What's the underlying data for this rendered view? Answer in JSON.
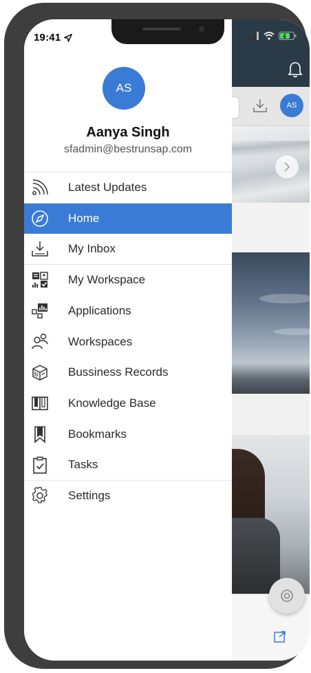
{
  "status_bar": {
    "time": "19:41"
  },
  "drawer": {
    "avatar_initials": "AS",
    "user_name": "Aanya Singh",
    "user_email": "sfadmin@bestrunsap.com",
    "items": [
      {
        "label": "Latest Updates",
        "icon": "rss-icon"
      },
      {
        "label": "Home",
        "icon": "compass-icon",
        "active": true
      },
      {
        "label": "My Inbox",
        "icon": "inbox-download-icon"
      },
      {
        "label": "My Workspace",
        "icon": "workspace-grid-icon"
      },
      {
        "label": "Applications",
        "icon": "applications-icon"
      },
      {
        "label": "Workspaces",
        "icon": "people-icon"
      },
      {
        "label": "Bussiness Records",
        "icon": "records-box-icon"
      },
      {
        "label": "Knowledge Base",
        "icon": "open-book-icon"
      },
      {
        "label": "Bookmarks",
        "icon": "bookmark-icon"
      },
      {
        "label": "Tasks",
        "icon": "clipboard-check-icon"
      },
      {
        "label": "Settings",
        "icon": "gear-icon"
      }
    ]
  },
  "background_app": {
    "avatar_initials": "AS"
  },
  "colors": {
    "accent": "#3a7bd5",
    "header_dark": "#2b3a47",
    "frame": "#3e3e3e"
  }
}
